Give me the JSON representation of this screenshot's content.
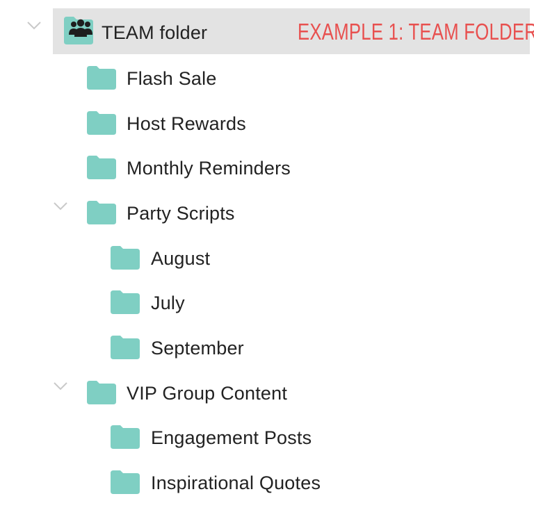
{
  "colors": {
    "folder": "#7fcfc3",
    "selected_row_bg": "#e3e3e3",
    "annotation": "#e8504f",
    "chevron": "#c9c9c9",
    "text": "#222222"
  },
  "root": {
    "label": "TEAM folder",
    "icon": "team-folder-icon",
    "expanded": true,
    "selected": true,
    "annotation": "EXAMPLE 1: TEAM FOLDER",
    "children": [
      {
        "label": "Flash Sale",
        "icon": "folder-icon"
      },
      {
        "label": "Host Rewards",
        "icon": "folder-icon"
      },
      {
        "label": "Monthly Reminders",
        "icon": "folder-icon"
      },
      {
        "label": "Party Scripts",
        "icon": "folder-icon",
        "expanded": true,
        "children": [
          {
            "label": "August",
            "icon": "folder-icon"
          },
          {
            "label": "July",
            "icon": "folder-icon"
          },
          {
            "label": "September",
            "icon": "folder-icon"
          }
        ]
      },
      {
        "label": "VIP Group Content",
        "icon": "folder-icon",
        "expanded": true,
        "children": [
          {
            "label": "Engagement Posts",
            "icon": "folder-icon"
          },
          {
            "label": "Inspirational Quotes",
            "icon": "folder-icon"
          }
        ]
      }
    ]
  }
}
